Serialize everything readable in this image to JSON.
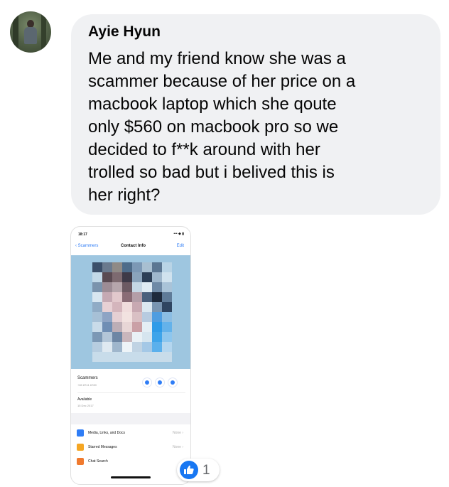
{
  "comment": {
    "author": "Ayie Hyun",
    "text": "Me and my friend know she was a\nscammer because of her price on a\nmacbook laptop which she qoute\nonly $560 on macbook pro so we\ndecided to f**k around with her\ntrolled so bad but i belived this is\nher right?",
    "bubble_color": "#f0f1f3"
  },
  "attachment": {
    "status_time": "18:17",
    "status_icons": "••• ◆ ▮",
    "nav": {
      "back_label": "‹ Scammers",
      "title": "Contact Info",
      "edit_label": "Edit"
    },
    "contact_name": "Scammers",
    "contact_phone": "+65 8741 6780",
    "availability": "Available",
    "availability_date": "15 Dec 2017",
    "rows": [
      {
        "label": "Media, Links, and Docs",
        "value": "None ›",
        "icon_color": "#2f7df6"
      },
      {
        "label": "Starred Messages",
        "value": "None ›",
        "icon_color": "#f5a623"
      },
      {
        "label": "Chat Search",
        "value": "",
        "icon_color": "#f07a2e"
      }
    ]
  },
  "reaction": {
    "icon": "like-icon",
    "count": "1",
    "color": "#1877f2"
  }
}
